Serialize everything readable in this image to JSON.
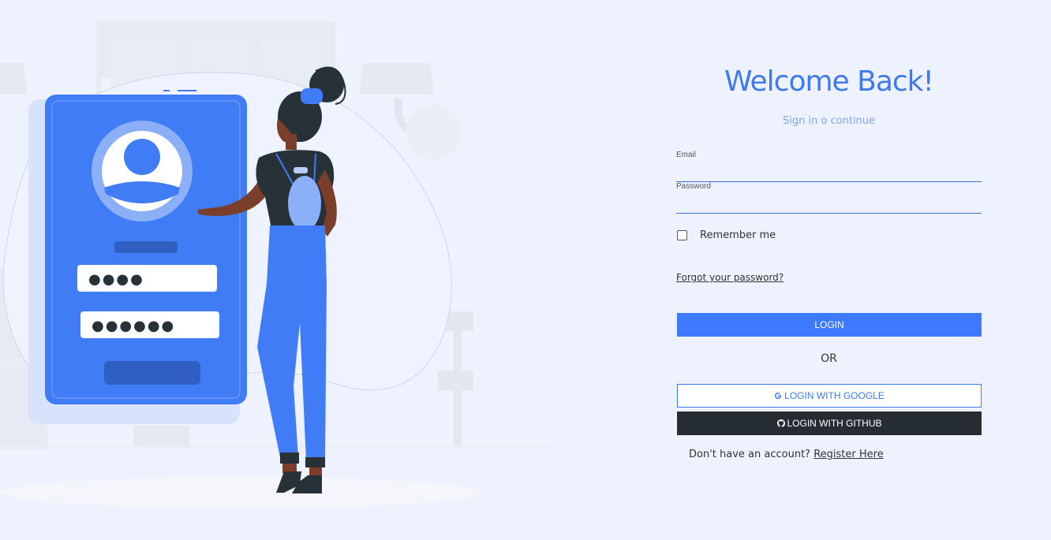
{
  "login": {
    "title": "Welcome Back!",
    "subtitle": "Sign in o continue",
    "email_label": "Email",
    "email_value": "",
    "password_label": "Password",
    "password_value": "",
    "remember_label": "Remember me",
    "remember_checked": false,
    "forgot_link": "Forgot your password?",
    "login_button": "LOGIN",
    "or_text": "OR",
    "google_button": "LOGIN WITH GOOGLE",
    "github_button": "LOGIN WITH GITHUB",
    "register_prompt": "Don't have an account?",
    "register_link": "Register Here"
  },
  "illustration": {
    "pin_masks": [
      "●●●●",
      "●●●●●●"
    ]
  },
  "colors": {
    "accent": "#3d7aff",
    "title": "#3d7aed",
    "github_dark": "#252d33",
    "background": "#edf2fe"
  },
  "icons": {
    "google": "google-icon",
    "github": "github-icon"
  }
}
